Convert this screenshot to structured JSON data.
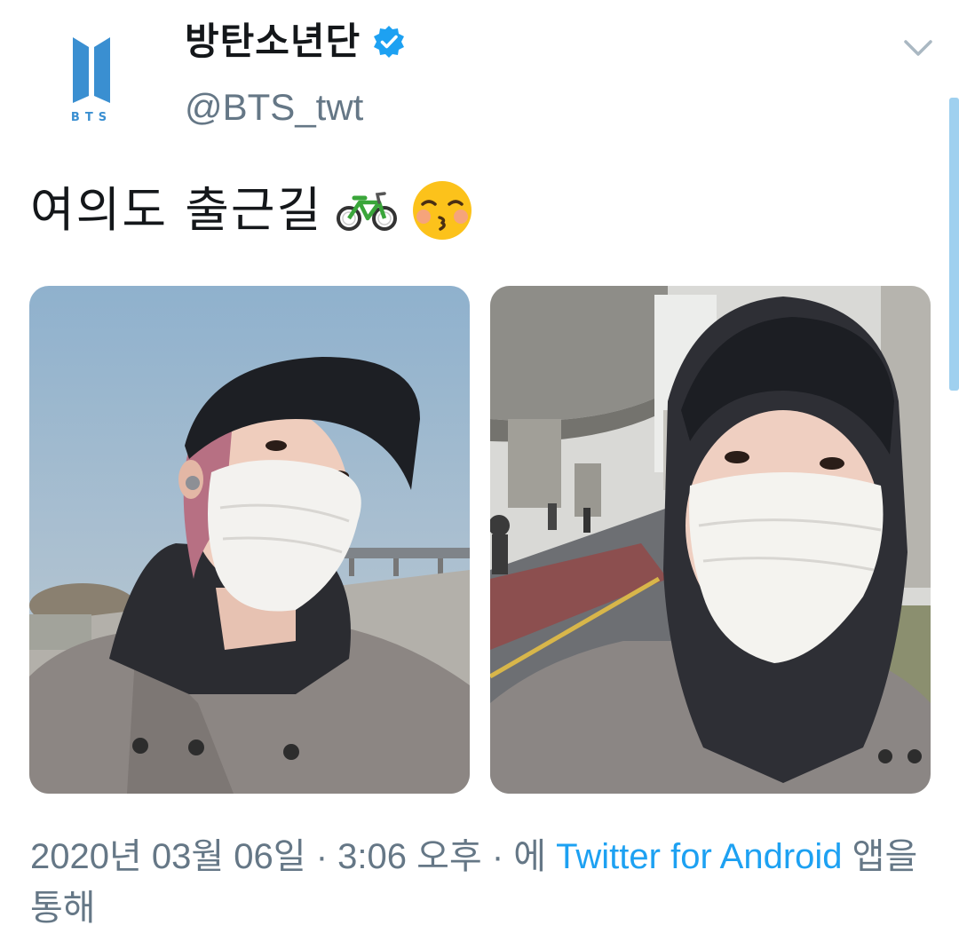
{
  "header": {
    "display_name": "방탄소년단",
    "handle": "@BTS_twt",
    "avatar_text": "BTS",
    "verified_icon": "verified-badge-icon",
    "menu_icon": "chevron-down-icon"
  },
  "tweet": {
    "text": "여의도 출근길",
    "emojis": [
      "bicycle-emoji",
      "kissing-face-emoji"
    ],
    "media": [
      {
        "description": "photo-1"
      },
      {
        "description": "photo-2"
      }
    ]
  },
  "meta": {
    "timestamp": "2020년 03월 06일 · 3:06 오후 · 에 ",
    "source_link": "Twitter for Android",
    "source_suffix": " 앱을 통해"
  },
  "colors": {
    "accent": "#1da1f2",
    "secondary_text": "#657786",
    "logo_blue": "#3a8fd1"
  }
}
